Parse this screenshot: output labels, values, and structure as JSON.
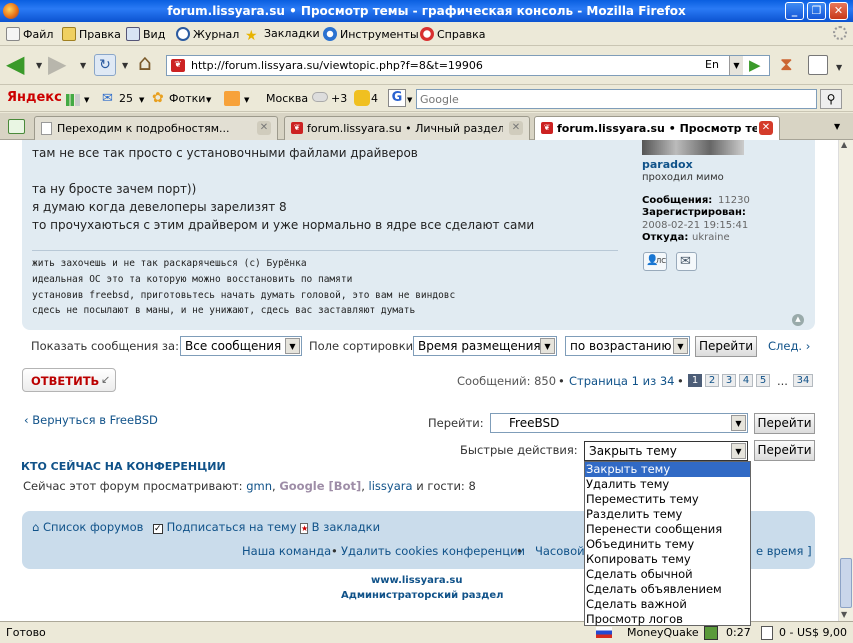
{
  "window": {
    "title": "forum.lissyara.su • Просмотр темы - графическая консоль - Mozilla Firefox"
  },
  "menubar": [
    "Файл",
    "Правка",
    "Вид",
    "Журнал",
    "Закладки",
    "Инструменты",
    "Справка"
  ],
  "navbar": {
    "url": "http://forum.lissyara.su/viewtopic.php?f=8&t=19906",
    "lang": "En"
  },
  "yandexbar": {
    "brand": "Яндекс",
    "mail_count": "25",
    "photos": "Фотки",
    "city": "Москва",
    "temp": "+3",
    "count": "4",
    "search_placeholder": "Google"
  },
  "tabs": [
    {
      "label": "Переходим к подробностям..."
    },
    {
      "label": "forum.lissyara.su • Личный раздел •..."
    },
    {
      "label": "forum.lissyara.su • Просмотр те..."
    }
  ],
  "post": {
    "lines": [
      "там не все так просто с установочными файлами драйверов",
      "та ну бросте зачем порт))",
      "я думаю когда девелоперы зарелизят 8",
      "то прочухаються с этим драйвером и уже нормально в ядре все сделают сами"
    ],
    "signature": [
      "жить захочешь и не так раскарячешься (с) Бурёнка",
      "идеальная ОС это та которую можно восстановить по памяти",
      "установив freebsd, приготовьтесь начать думать головой, это вам не виндовс",
      "сдесь не посылают в маны, и не унижают, сдесь вас заставляют думать"
    ]
  },
  "profile": {
    "name": "paradox",
    "rank": "проходил мимо",
    "posts_label": "Сообщения:",
    "posts_value": "11230",
    "reg_label": "Зарегистрирован:",
    "reg_value": "2008-02-21 19:15:41",
    "from_label": "Откуда:",
    "from_value": "ukraine",
    "pm_label": "ЛС"
  },
  "display": {
    "label": "Показать сообщения за:",
    "period": "Все сообщения",
    "sort_label": "Поле сортировки",
    "sort_field": "Время размещения",
    "order": "по возрастанию",
    "go": "Перейти",
    "next": "След."
  },
  "reply": {
    "label": "ОТВЕТИТЬ"
  },
  "pagination": {
    "messages": "Сообщений: 850",
    "page": "Страница",
    "current": "1",
    "of": "из",
    "total": "34",
    "pages": [
      "1",
      "2",
      "3",
      "4",
      "5"
    ],
    "ellipsis": "...",
    "last": "34"
  },
  "back": {
    "label": "Вернуться в FreeBSD"
  },
  "jump": {
    "label": "Перейти:",
    "value": "FreeBSD",
    "go": "Перейти"
  },
  "quick": {
    "label": "Быстрые действия:",
    "value": "Закрыть тему",
    "go": "Перейти",
    "options": [
      "Закрыть тему",
      "Удалить тему",
      "Переместить тему",
      "Разделить тему",
      "Перенести сообщения",
      "Объединить тему",
      "Копировать тему",
      "Сделать обычной",
      "Сделать объявлением",
      "Сделать важной",
      "Просмотр логов"
    ]
  },
  "online": {
    "title": "КТО СЕЙЧАС НА КОНФЕРЕНЦИИ",
    "prefix": "Сейчас этот форум просматривают:",
    "users": [
      "gmn",
      "Google [Bot]",
      "lissyara"
    ],
    "suffix": "и гости: 8"
  },
  "navlinks": {
    "index": "Список форумов",
    "subscribe": "Подписаться на тему",
    "bookmark": "В закладки",
    "team": "Наша команда",
    "delete_cookies": "Удалить cookies конференции",
    "timezone": "Часовой",
    "time_tail": "е время ]"
  },
  "footer": {
    "site": "www.lissyara.su",
    "admin": "Администраторский раздел"
  },
  "status": {
    "text": "Готово",
    "moneyquake": "MoneyQuake",
    "time": "0:27",
    "money": "0 - US$ 9,00"
  }
}
